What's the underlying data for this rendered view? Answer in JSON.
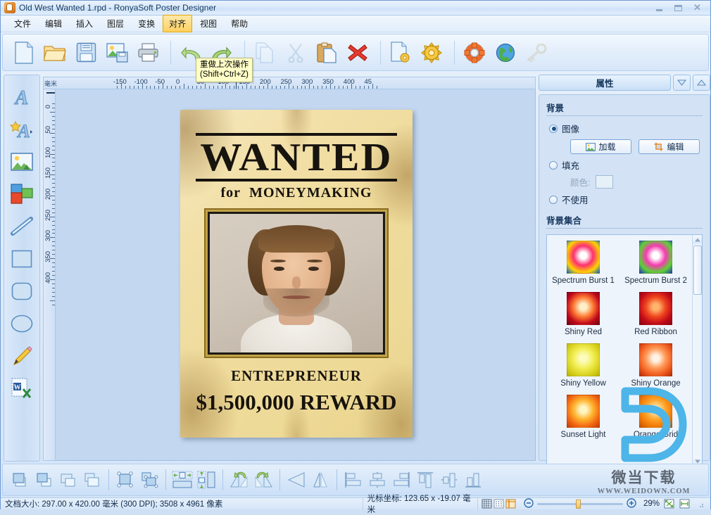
{
  "window": {
    "title": "Old West Wanted 1.rpd - RonyaSoft Poster Designer",
    "icon": "app-icon",
    "minimize": "–",
    "maximize": "□",
    "close": "✕"
  },
  "menu": {
    "items": [
      {
        "label": "文件",
        "active": false
      },
      {
        "label": "编辑",
        "active": false
      },
      {
        "label": "插入",
        "active": false
      },
      {
        "label": "图层",
        "active": false
      },
      {
        "label": "变换",
        "active": false
      },
      {
        "label": "对齐",
        "active": true
      },
      {
        "label": "视图",
        "active": false
      },
      {
        "label": "帮助",
        "active": false
      }
    ]
  },
  "toolbar": {
    "buttons": [
      {
        "name": "new-document-icon",
        "enabled": true
      },
      {
        "name": "open-document-icon",
        "enabled": true
      },
      {
        "name": "save-icon",
        "enabled": true
      },
      {
        "name": "save-as-image-icon",
        "enabled": true
      },
      {
        "name": "print-icon",
        "enabled": true
      },
      {
        "name": "separator",
        "enabled": true
      },
      {
        "name": "undo-icon",
        "enabled": true
      },
      {
        "name": "redo-icon",
        "enabled": true
      },
      {
        "name": "separator",
        "enabled": true
      },
      {
        "name": "copy-icon",
        "enabled": false
      },
      {
        "name": "cut-icon",
        "enabled": false
      },
      {
        "name": "paste-icon",
        "enabled": true
      },
      {
        "name": "delete-icon",
        "enabled": true
      },
      {
        "name": "separator",
        "enabled": true
      },
      {
        "name": "page-setup-icon",
        "enabled": true
      },
      {
        "name": "settings-gear-icon",
        "enabled": true
      },
      {
        "name": "separator",
        "enabled": true
      },
      {
        "name": "help-lifebuoy-icon",
        "enabled": true
      },
      {
        "name": "web-globe-icon",
        "enabled": true
      },
      {
        "name": "register-key-icon",
        "enabled": false
      }
    ]
  },
  "tooltip": {
    "line1": "重做上次操作",
    "line2": "(Shift+Ctrl+Z)"
  },
  "left_tools": {
    "items": [
      {
        "name": "text-tool-icon",
        "label": "Text"
      },
      {
        "name": "artistic-text-tool-icon",
        "label": "Artistic Text"
      },
      {
        "name": "image-tool-icon",
        "label": "Image"
      },
      {
        "name": "clipart-tool-icon",
        "label": "Clipart"
      },
      {
        "name": "line-tool-icon",
        "label": "Line"
      },
      {
        "name": "rectangle-tool-icon",
        "label": "Rectangle"
      },
      {
        "name": "rounded-rect-tool-icon",
        "label": "Rounded Rectangle"
      },
      {
        "name": "ellipse-tool-icon",
        "label": "Ellipse"
      },
      {
        "name": "pencil-tool-icon",
        "label": "Pencil"
      },
      {
        "name": "mail-merge-tool-icon",
        "label": "Mail Merge"
      }
    ]
  },
  "ruler": {
    "unit": "毫米",
    "h_labels": [
      "-150",
      "-100",
      "-50",
      "0",
      "50",
      "100",
      "150",
      "200",
      "250",
      "300",
      "350",
      "400",
      "45"
    ],
    "v_labels": [
      "0",
      "50",
      "100",
      "150",
      "200",
      "250",
      "300",
      "350",
      "400"
    ]
  },
  "poster": {
    "headline": "WANTED",
    "subline_for": "for",
    "subline_name": "MONEYMAKING",
    "photo_alt": "portrait-photo",
    "occupation": "ENTREPRENEUR",
    "reward": "$1,500,000  REWARD"
  },
  "properties": {
    "title": "属性",
    "chevron_down": "▼",
    "chevron_up": "▲",
    "background": {
      "section_title": "背景",
      "option_image": "图像",
      "option_fill": "填充",
      "option_none": "不使用",
      "selected": "图像",
      "load_button": "加载",
      "edit_button": "编辑",
      "color_label": "颜色:",
      "color_value": "#e6f0f7"
    },
    "collection": {
      "section_title": "背景集合",
      "items": [
        {
          "name": "Spectrum Burst 1",
          "c1": "#ffffff",
          "c2": "#ff2f6e",
          "c3": "#ffd400",
          "c4": "#0b63c4"
        },
        {
          "name": "Spectrum Burst 2",
          "c1": "#ffffff",
          "c2": "#f53ab0",
          "c3": "#5ad432",
          "c4": "#2a34b8"
        },
        {
          "name": "Shiny Red",
          "c1": "#fff0c9",
          "c2": "#ff7a33",
          "c3": "#c1081a",
          "c4": "#6d0310"
        },
        {
          "name": "Red Ribbon",
          "c1": "#ffb36b",
          "c2": "#f0461f",
          "c3": "#c00a18",
          "c4": "#8c0410"
        },
        {
          "name": "Shiny Yellow",
          "c1": "#fdfbbd",
          "c2": "#f2ef57",
          "c3": "#d9d220",
          "c4": "#b9b000"
        },
        {
          "name": "Shiny Orange",
          "c1": "#fff3e6",
          "c2": "#ff9a57",
          "c3": "#ef5a1e",
          "c4": "#b32c06"
        },
        {
          "name": "Sunset Light",
          "c1": "#fff6c4",
          "c2": "#ffb42e",
          "c3": "#f26711",
          "c4": "#c43c05"
        },
        {
          "name": "Orange Grid",
          "c1": "#ffe0a8",
          "c2": "#ffa52b",
          "c3": "#f07a06",
          "c4": "#c25400"
        }
      ]
    }
  },
  "align_toolbar": {
    "groups": [
      [
        "bring-to-front-icon",
        "bring-forward-icon",
        "send-backward-icon",
        "send-to-back-icon"
      ],
      [
        "group-objects-icon",
        "ungroup-objects-icon"
      ],
      [
        "center-horizontally-icon",
        "center-vertically-icon"
      ],
      [
        "rotate-left-icon",
        "rotate-right-icon"
      ],
      [
        "flip-horizontal-icon",
        "flip-vertical-icon"
      ],
      [
        "align-left-icon",
        "align-center-icon",
        "align-right-icon",
        "align-top-icon",
        "align-middle-icon",
        "align-bottom-icon"
      ]
    ]
  },
  "watermark": {
    "cn": "微当下载",
    "en": "WWW.WEIDOWN.COM",
    "logo": "d-logo"
  },
  "statusbar": {
    "document_size": "文档大小: 297.00 x 420.00 毫米 (300 DPI); 3508 x 4961 像素",
    "cursor_position": "光标坐标: 123.65 x -19.07 毫米",
    "grid_icon": "grid-icon",
    "dot_grid_icon": "dot-grid-icon",
    "guides_icon": "guides-icon",
    "zoom_out": "−",
    "zoom_in": "+",
    "zoom_level": "29%",
    "fit_page_icon": "fit-page-icon",
    "fit_width_icon": "fit-width-icon"
  }
}
